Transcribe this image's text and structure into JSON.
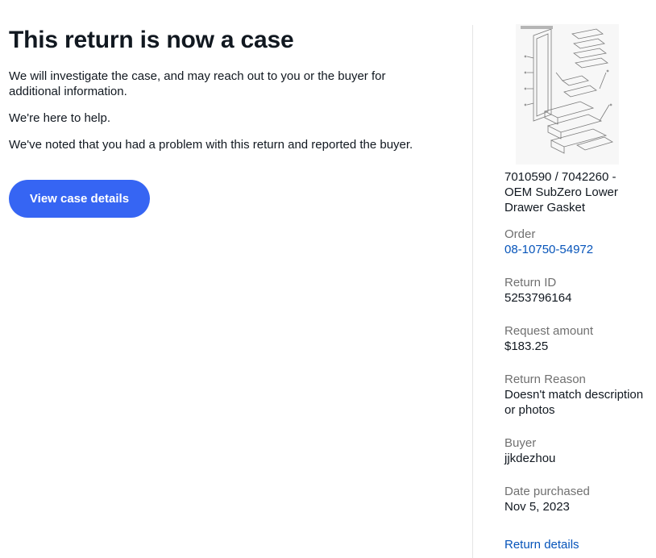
{
  "main": {
    "title": "This return is now a case",
    "paragraphs": [
      "We will investigate the case, and may reach out to you or the buyer for additional information.",
      "We're here to help.",
      "We've noted that you had a problem with this return and reported the buyer."
    ],
    "button_label": "View case details"
  },
  "sidebar": {
    "item_title": "7010590 / 7042260 - OEM SubZero Lower Drawer Gasket",
    "fields": {
      "order": {
        "label": "Order",
        "value": "08-10750-54972"
      },
      "return_id": {
        "label": "Return ID",
        "value": "5253796164"
      },
      "request_amount": {
        "label": "Request amount",
        "value": "$183.25"
      },
      "return_reason": {
        "label": "Return Reason",
        "value": "Doesn't match description or photos"
      },
      "buyer": {
        "label": "Buyer",
        "value": "jjkdezhou"
      },
      "date_purchased": {
        "label": "Date purchased",
        "value": "Nov 5, 2023"
      }
    },
    "return_details_link": "Return details"
  },
  "colors": {
    "primary_button": "#3665f3",
    "link": "#0654ba",
    "label_gray": "#707070",
    "text": "#111820"
  }
}
